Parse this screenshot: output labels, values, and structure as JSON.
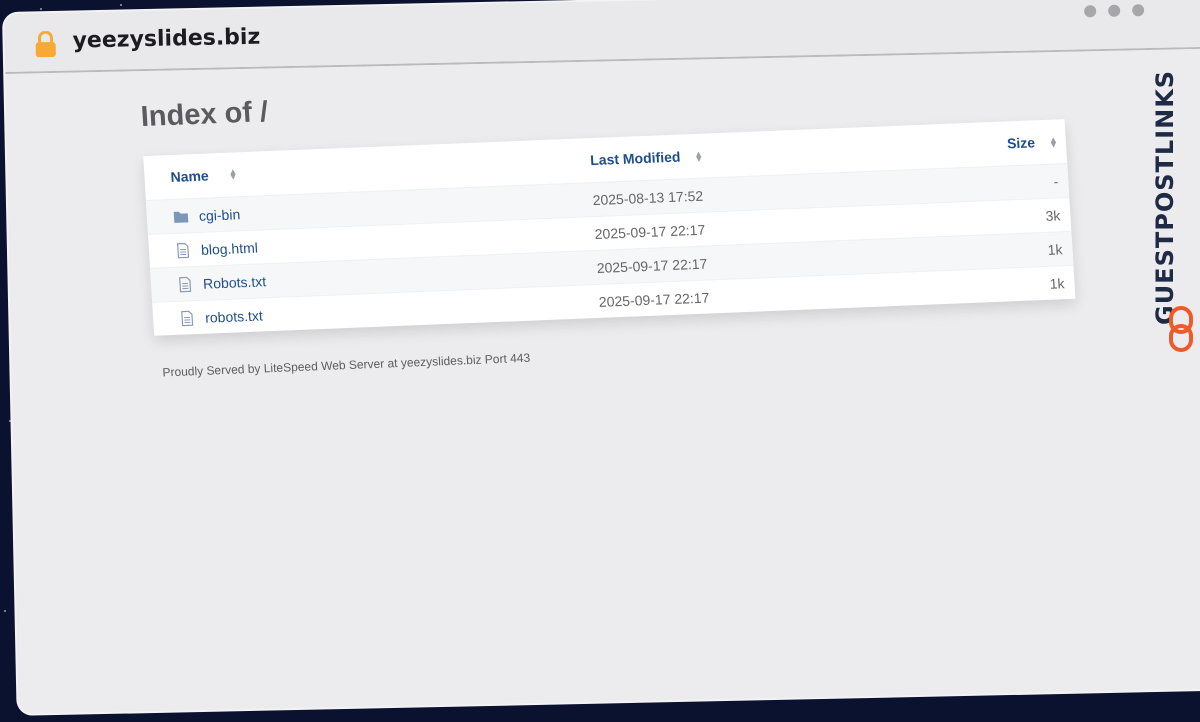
{
  "browser": {
    "url": "yeezyslides.biz",
    "lock_icon": "lock-icon"
  },
  "page": {
    "title": "Index of /",
    "columns": {
      "name": "Name",
      "modified": "Last Modified",
      "size": "Size"
    },
    "rows": [
      {
        "name": "cgi-bin",
        "modified": "2025-08-13 17:52",
        "size": "-",
        "icon": "folder-icon"
      },
      {
        "name": "blog.html",
        "modified": "2025-09-17 22:17",
        "size": "3k",
        "icon": "file-icon"
      },
      {
        "name": "Robots.txt",
        "modified": "2025-09-17 22:17",
        "size": "1k",
        "icon": "file-icon"
      },
      {
        "name": "robots.txt",
        "modified": "2025-09-17 22:17",
        "size": "1k",
        "icon": "file-icon"
      }
    ],
    "footer": "Proudly Served by LiteSpeed Web Server at yeezyslides.biz Port 443"
  },
  "watermark": {
    "text": "GUESTPOSTLINKS",
    "accent_color": "#f05a28"
  },
  "colors": {
    "background": "#0b1230",
    "link": "#1f4e8c",
    "lock": "#f7a935"
  }
}
